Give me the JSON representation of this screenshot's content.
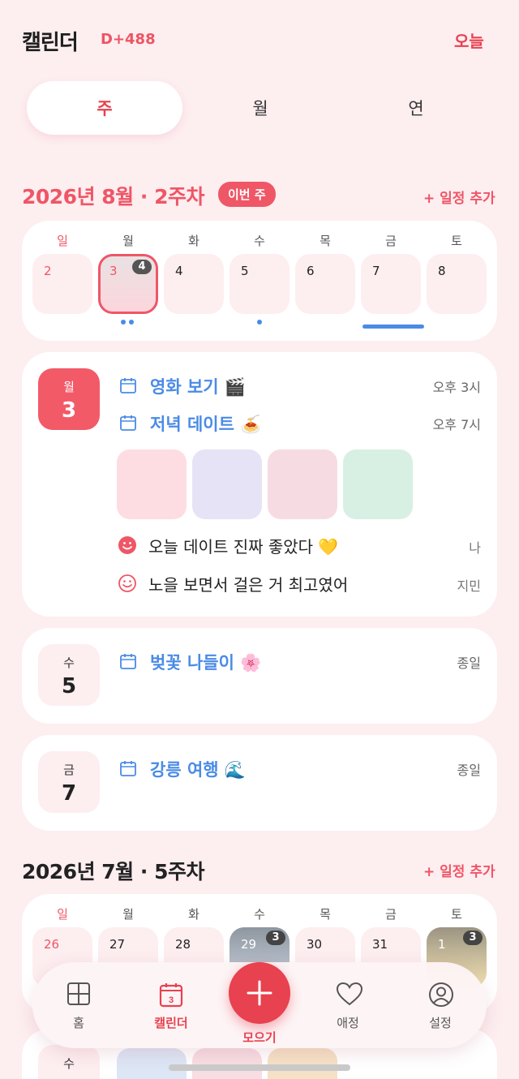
{
  "header": {
    "title": "캘린더",
    "dday": "D+488",
    "today_label": "오늘"
  },
  "segments": [
    "주",
    "월",
    "연"
  ],
  "active_segment": "주",
  "weekdays": [
    "일",
    "월",
    "화",
    "수",
    "목",
    "금",
    "토"
  ],
  "week1": {
    "title": "2026년 8월 · 2주차",
    "badge": "이번 주",
    "add_label": "+ 일정 추가",
    "days": [
      {
        "num": "2",
        "count": ""
      },
      {
        "num": "3",
        "count": "4",
        "selected": true
      },
      {
        "num": "4",
        "count": ""
      },
      {
        "num": "5",
        "count": ""
      },
      {
        "num": "6",
        "count": ""
      },
      {
        "num": "7",
        "count": ""
      },
      {
        "num": "8",
        "count": ""
      }
    ],
    "cards": [
      {
        "weekday": "월",
        "day": "3",
        "events": [
          {
            "title": "영화 보기 🎬",
            "time": "오후 3시"
          },
          {
            "title": "저녁 데이트 🍝",
            "time": "오후 7시"
          }
        ],
        "photos": [
          "#fddde2",
          "#e7e3f6",
          "#f7dbe3",
          "#d8f0e3"
        ],
        "memos": [
          {
            "text": "오늘 데이트 진짜 좋았다 💛",
            "author": "나"
          },
          {
            "text": "노을 보면서 걸은 거 최고였어",
            "author": "지민"
          }
        ]
      },
      {
        "weekday": "수",
        "day": "5",
        "events": [
          {
            "title": "벚꽃 나들이 🌸",
            "time": "종일"
          }
        ]
      },
      {
        "weekday": "금",
        "day": "7",
        "events": [
          {
            "title": "강릉 여행 🌊",
            "time": "종일"
          }
        ]
      }
    ]
  },
  "week2": {
    "title": "2026년 7월 · 5주차",
    "add_label": "+ 일정 추가",
    "days": [
      {
        "num": "26",
        "count": ""
      },
      {
        "num": "27",
        "count": ""
      },
      {
        "num": "28",
        "count": ""
      },
      {
        "num": "29",
        "count": "3"
      },
      {
        "num": "30",
        "count": ""
      },
      {
        "num": "31",
        "count": ""
      },
      {
        "num": "1",
        "count": "3"
      }
    ],
    "next_card": {
      "weekday": "수"
    }
  },
  "nav": [
    {
      "label": "홈",
      "icon": "grid-icon"
    },
    {
      "label": "캘린더",
      "icon": "calendar-icon",
      "active": true,
      "badge": "3"
    },
    {
      "label": "모으기",
      "icon": "plus-icon"
    },
    {
      "label": "애정",
      "icon": "heart-icon"
    },
    {
      "label": "설정",
      "icon": "profile-icon"
    }
  ],
  "colors": {
    "accent": "#e8414f",
    "pink_bg": "#fdeef0",
    "event_blue": "#4a8be6",
    "soft_red": "#ef5666"
  }
}
